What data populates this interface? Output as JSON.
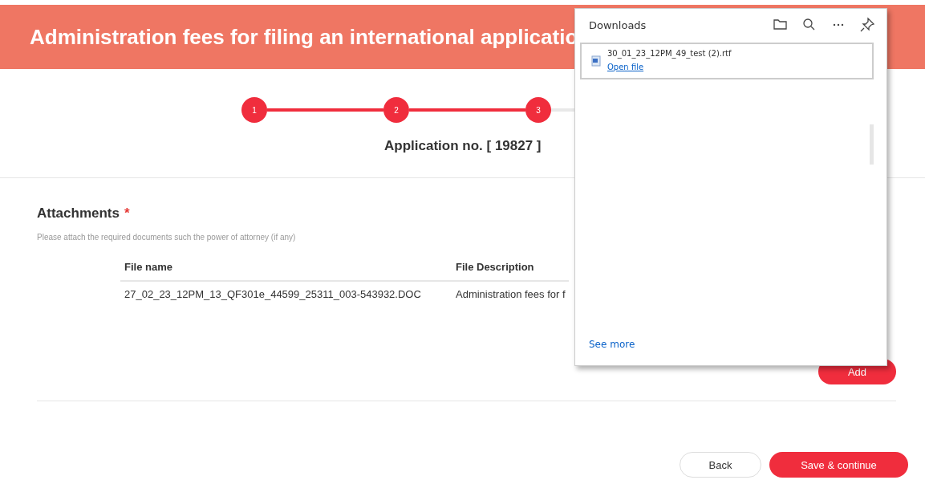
{
  "header": {
    "title": "Administration fees for filing an international applicatio"
  },
  "stepper": {
    "steps": [
      {
        "label": "1"
      },
      {
        "label": "2"
      },
      {
        "label": "3"
      }
    ],
    "application_no": "Application no. [ 19827 ]"
  },
  "attachments": {
    "title": "Attachments",
    "required_mark": "*",
    "hint": "Please attach the required documents such the power of attorney (if any)",
    "columns": [
      "File name",
      "File Description"
    ],
    "rows": [
      [
        "27_02_23_12PM_13_QF301e_44599_25311_003-543932.DOC",
        "Administration fees for f"
      ]
    ],
    "add_button": "Add"
  },
  "footer": {
    "buttons": [
      {
        "label": "Back",
        "kind": "secondary"
      },
      {
        "label": "Save & continue",
        "kind": "primary"
      }
    ]
  },
  "downloads": {
    "title": "Downloads",
    "items": [
      {
        "name": "30_01_23_12PM_49_test (2).rtf",
        "link": "Open file"
      }
    ],
    "see_more": "See more"
  }
}
